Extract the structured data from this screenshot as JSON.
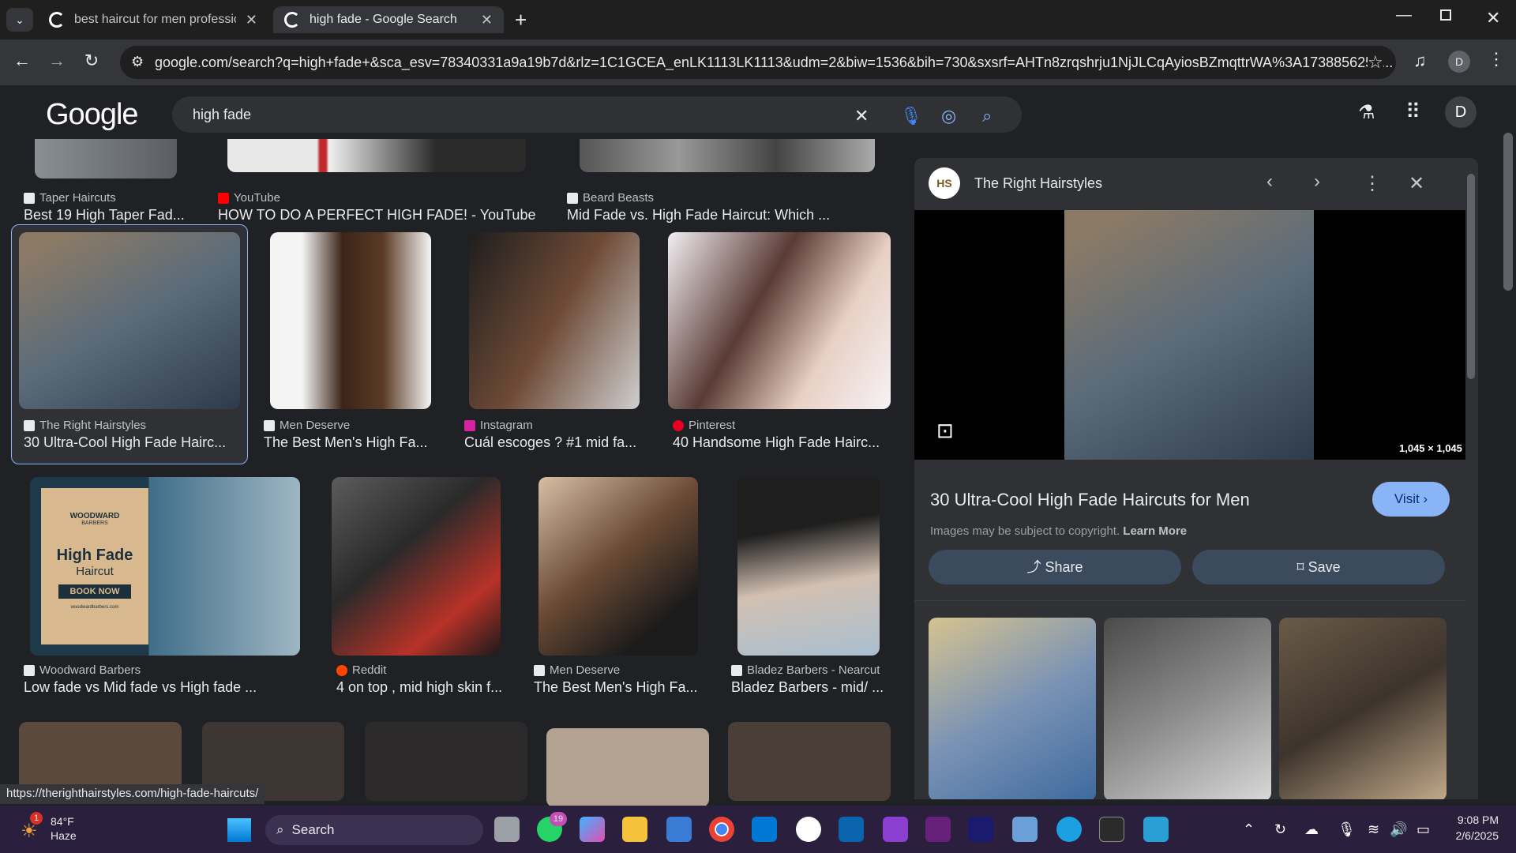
{
  "tabs": [
    {
      "title": "best haircut for men profession",
      "active": false
    },
    {
      "title": "high fade - Google Search",
      "active": true
    }
  ],
  "url": "google.com/search?q=high+fade+&sca_esv=78340331a9a19b7d&rlz=1C1GCEA_enLK1113LK1113&udm=2&biw=1536&bih=730&sxsrf=AHTn8zrqshrju1NjJLCqAyiosBZmqttrWA%3A1738856255...",
  "profile_initial": "D",
  "google_logo": "Google",
  "search_query": "high fade",
  "results_row0": [
    {
      "source": "Taper Haircuts",
      "title": "Best 19 High Taper Fad..."
    },
    {
      "source": "YouTube",
      "title": "HOW TO DO A PERFECT HIGH FADE! - YouTube"
    },
    {
      "source": "Beard Beasts",
      "title": "Mid Fade vs. High Fade Haircut: Which ..."
    }
  ],
  "results_row1": [
    {
      "source": "The Right Hairstyles",
      "title": "30 Ultra-Cool High Fade Hairc..."
    },
    {
      "source": "Men Deserve",
      "title": "The Best Men's High Fa..."
    },
    {
      "source": "Instagram",
      "title": "Cuál escoges ? #1 mid fa..."
    },
    {
      "source": "Pinterest",
      "title": "40 Handsome High Fade Hairc..."
    }
  ],
  "results_row2": [
    {
      "source": "Woodward Barbers",
      "title": "Low fade vs Mid fade vs High fade ..."
    },
    {
      "source": "Reddit",
      "title": "4 on top , mid high skin f..."
    },
    {
      "source": "Men Deserve",
      "title": "The Best Men's High Fa..."
    },
    {
      "source": "Bladez Barbers - Nearcut",
      "title": "Bladez Barbers - mid/ ..."
    }
  ],
  "ad_image": {
    "brand": "WOODWARD",
    "sub": "BARBERS",
    "line1": "High Fade",
    "line2": "Haircut",
    "cta": "BOOK NOW",
    "url": "woodwardbarbers.com"
  },
  "panel": {
    "logo_text": "HS",
    "source": "The Right Hairstyles",
    "dimensions": "1,045 × 1,045",
    "title": "30 Ultra-Cool High Fade Haircuts for Men",
    "visit": "Visit",
    "copyright": "Images may be subject to copyright.",
    "learn_more": "Learn More",
    "share": "Share",
    "save": "Save"
  },
  "status_url": "https://therighthairstyles.com/high-fade-haircuts/",
  "weather": {
    "temp": "84°F",
    "condition": "Haze",
    "badge": "1"
  },
  "taskbar_search": "Search",
  "whatsapp_badge": "19",
  "clock": {
    "time": "9:08 PM",
    "date": "2/6/2025"
  }
}
